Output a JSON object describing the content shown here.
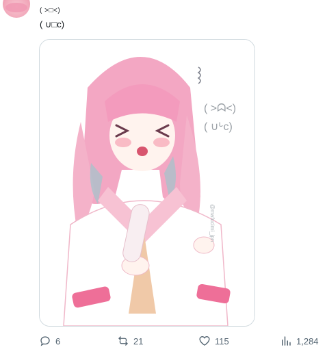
{
  "tweet": {
    "line1": "( >□<)",
    "line2": "( ∪□c)"
  },
  "media": {
    "overlay_text_1": "( >ᗣ<)",
    "overlay_text_2": "( ∪ᒡc)",
    "watermark": "@mafucimi_jpn"
  },
  "actions": {
    "replies": "6",
    "reposts": "21",
    "likes": "115",
    "views": "1,284"
  },
  "colors": {
    "icon": "#536471",
    "border": "#cfd9de",
    "hair": "#f3a7c3",
    "accent_pink": "#ee6f98"
  }
}
